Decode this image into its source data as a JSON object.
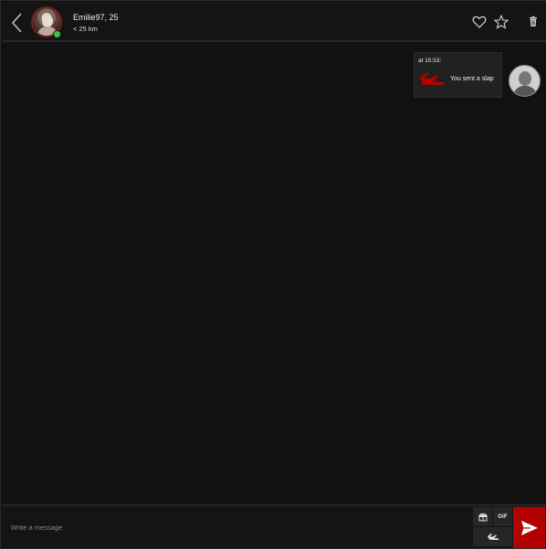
{
  "header": {
    "user_name": "Emilie97, 25",
    "distance": "< 25 km",
    "online": true,
    "icons": [
      "back-icon",
      "heart-icon",
      "star-icon",
      "trash-icon"
    ]
  },
  "messages": [
    {
      "time": "at 15:53:",
      "icon": "slap-icon",
      "text": "You sent a slap"
    }
  ],
  "composer": {
    "placeholder": "Write a message",
    "gif_label": "GIF",
    "tools": [
      "gift-icon",
      "gif-button",
      "slap-tool-icon"
    ],
    "send_icon": "send-icon"
  },
  "colors": {
    "background": "#111111",
    "accent": "#b30000",
    "online": "#3ec43e"
  }
}
